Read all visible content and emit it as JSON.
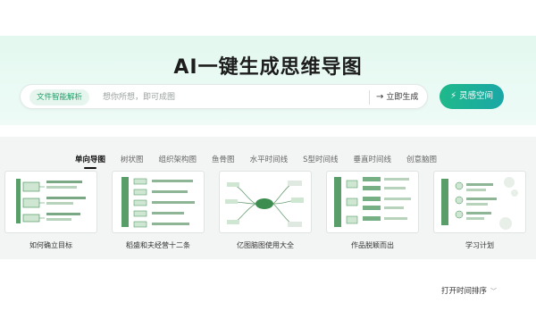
{
  "hero": {
    "title": "AI一键生成思维导图"
  },
  "search": {
    "file_tag": "文件智能解析",
    "placeholder": "想你所想，即可成图",
    "generate_label": "立即生成",
    "inspire_label": "灵感空间"
  },
  "tabs": [
    {
      "label": "单向导图",
      "active": true
    },
    {
      "label": "树状图",
      "active": false
    },
    {
      "label": "组织架构图",
      "active": false
    },
    {
      "label": "鱼骨图",
      "active": false
    },
    {
      "label": "水平时间线",
      "active": false
    },
    {
      "label": "S型时间线",
      "active": false
    },
    {
      "label": "垂直时间线",
      "active": false
    },
    {
      "label": "创意脑图",
      "active": false
    }
  ],
  "cards": [
    {
      "label": "如何确立目标",
      "style": "right-tree"
    },
    {
      "label": "稻盛和夫经营十二条",
      "style": "list"
    },
    {
      "label": "亿图脑图使用大全",
      "style": "radial"
    },
    {
      "label": "作品脱颖而出",
      "style": "left-tree"
    },
    {
      "label": "学习计划",
      "style": "plan"
    }
  ],
  "sort": {
    "label": "打开时间排序"
  },
  "colors": {
    "accent": "#1fb98a",
    "accent_end": "#1aa7a6",
    "thumb_green": "#3c8d4f"
  }
}
